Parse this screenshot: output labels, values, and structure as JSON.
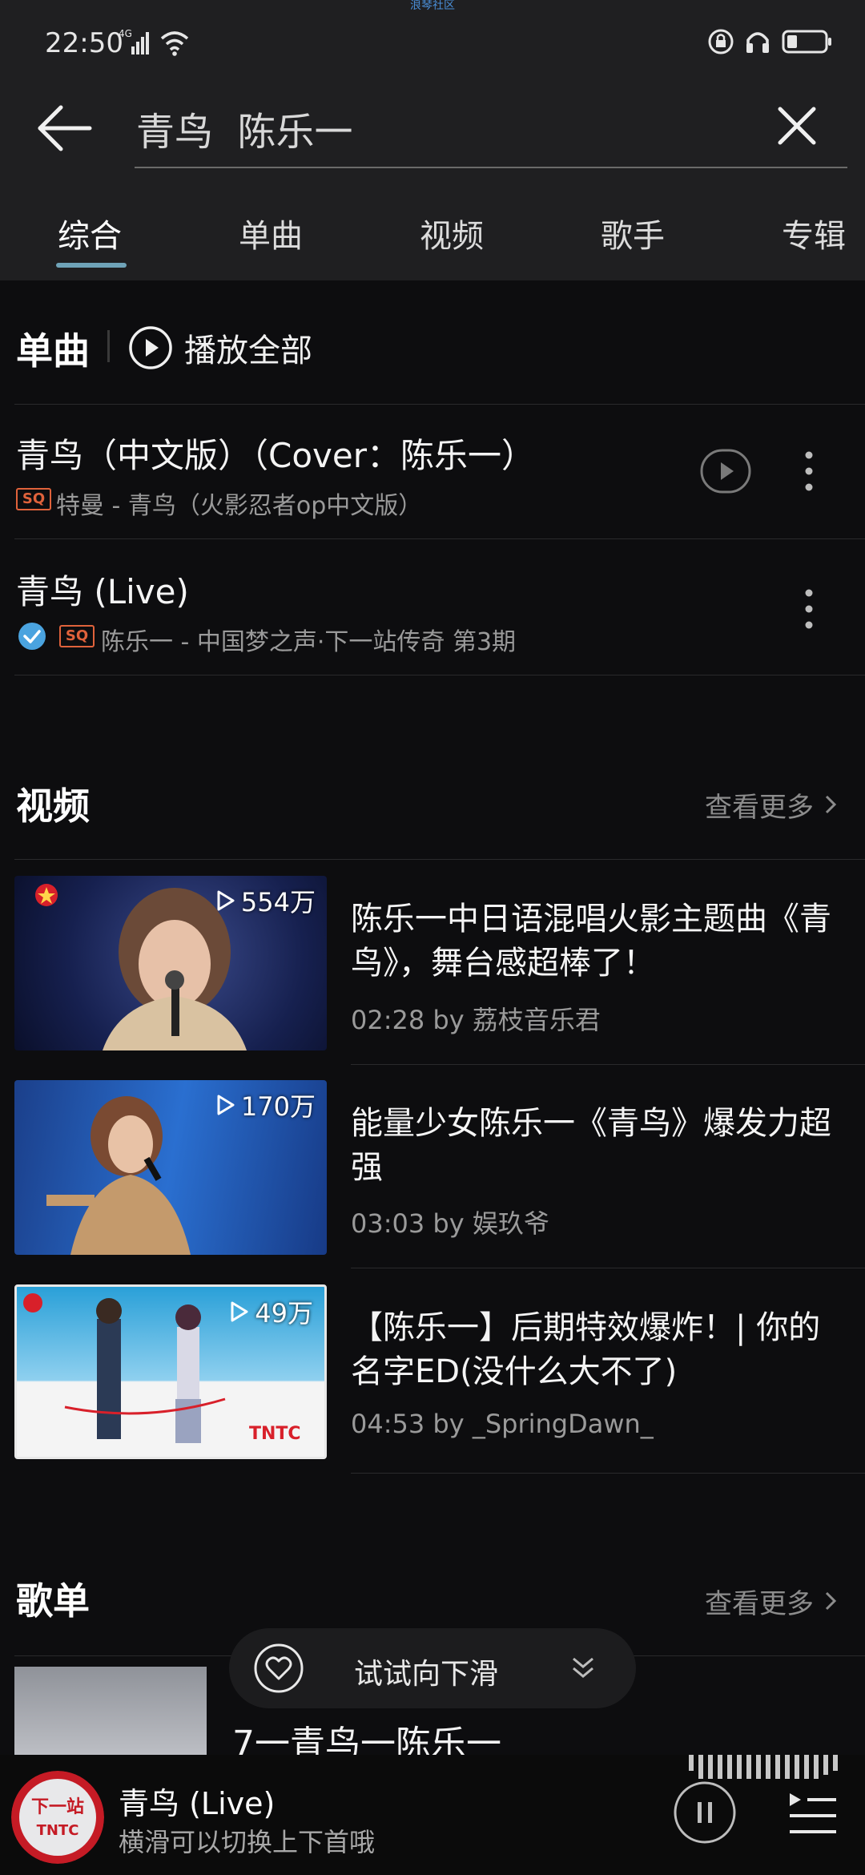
{
  "top_banner": "浪琴社区",
  "status_bar": {
    "time": "22:50",
    "network": "4G"
  },
  "search": {
    "query": "青鸟  陈乐一"
  },
  "tabs": [
    "综合",
    "单曲",
    "视频",
    "歌手",
    "专辑"
  ],
  "songs_section": {
    "title": "单曲",
    "play_all_label": "播放全部",
    "items": [
      {
        "title": "青鸟（中文版）（Cover：陈乐一）",
        "badge": "SQ",
        "subtitle": "特曼 - 青鸟（火影忍者op中文版）"
      },
      {
        "title": "青鸟 (Live)",
        "badge": "SQ",
        "subtitle": "陈乐一 - 中国梦之声·下一站传奇 第3期"
      }
    ]
  },
  "videos_section": {
    "title": "视频",
    "see_more": "查看更多",
    "items": [
      {
        "views": "554万",
        "title": "陈乐一中日语混唱火影主题曲《青鸟》，舞台感超棒了！",
        "meta": "02:28 by 荔枝音乐君"
      },
      {
        "views": "170万",
        "title": "能量少女陈乐一《青鸟》爆发力超强",
        "meta": "03:03 by 娱玖爷"
      },
      {
        "views": "49万",
        "title": "【陈乐一】后期特效爆炸！| 你的名字ED(没什么大不了)",
        "meta": "04:53 by _SpringDawn_"
      }
    ]
  },
  "playlist_section": {
    "title": "歌单",
    "see_more": "查看更多",
    "first_item": "7一青鸟一陈乐一"
  },
  "swipe_hint": {
    "label": "试试向下滑"
  },
  "player": {
    "title": "青鸟 (Live)",
    "subtitle": "横滑可以切换上下首哦"
  },
  "colors": {
    "header_bg": "#1f1f21",
    "page_bg": "#0d0d0f",
    "accent_tab": "#6fa3b8",
    "sq_badge": "#e0623b",
    "verified": "#4aa3df"
  }
}
